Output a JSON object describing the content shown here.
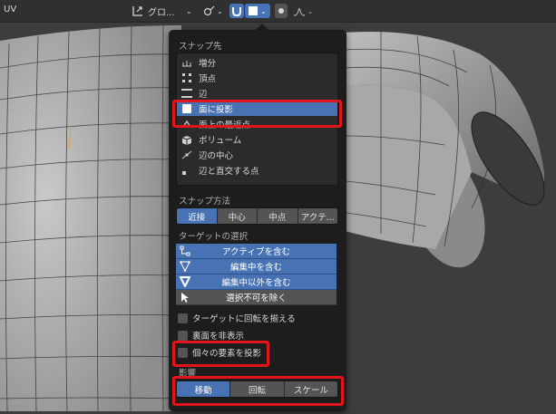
{
  "header": {
    "mode_label": "UV",
    "pivot_label": "グロ...",
    "accent_color": "#4772b3"
  },
  "snap_popup": {
    "snap_target_title": "スナップ先",
    "snap_targets": [
      {
        "label": "増分",
        "icon": "increment-icon",
        "selected": false
      },
      {
        "label": "頂点",
        "icon": "vertex-icon",
        "selected": false
      },
      {
        "label": "辺",
        "icon": "edge-icon",
        "selected": false
      },
      {
        "label": "面に投影",
        "icon": "face-project-icon",
        "selected": true
      },
      {
        "label": "面上の最近点",
        "icon": "face-nearest-icon",
        "selected": false
      },
      {
        "label": "ボリューム",
        "icon": "volume-icon",
        "selected": false
      },
      {
        "label": "辺の中心",
        "icon": "edge-center-icon",
        "selected": false
      },
      {
        "label": "辺と直交する点",
        "icon": "edge-perpendicular-icon",
        "selected": false
      }
    ],
    "snap_with_title": "スナップ方法",
    "snap_with": [
      {
        "label": "近接",
        "active": true
      },
      {
        "label": "中心",
        "active": false
      },
      {
        "label": "中点",
        "active": false
      },
      {
        "label": "アクテ...",
        "active": false
      }
    ],
    "target_selection_title": "ターゲットの選択",
    "target_selection": [
      {
        "label": "アクティブを含む",
        "icon": "include-active-icon",
        "on": true
      },
      {
        "label": "編集中を含む",
        "icon": "include-edited-icon",
        "on": true
      },
      {
        "label": "編集中以外を含む",
        "icon": "include-nonedited-icon",
        "on": true
      },
      {
        "label": "選択不可を除く",
        "icon": "exclude-nonselectable-icon",
        "on": false
      }
    ],
    "checkboxes": [
      {
        "label": "ターゲットに回転を揃える",
        "checked": false
      },
      {
        "label": "裏面を非表示",
        "checked": false
      },
      {
        "label": "個々の要素を投影",
        "checked": false
      }
    ],
    "affect_title": "影響",
    "affect": [
      {
        "label": "移動",
        "active": true
      },
      {
        "label": "回転",
        "active": false
      },
      {
        "label": "スケール",
        "active": false
      }
    ]
  }
}
